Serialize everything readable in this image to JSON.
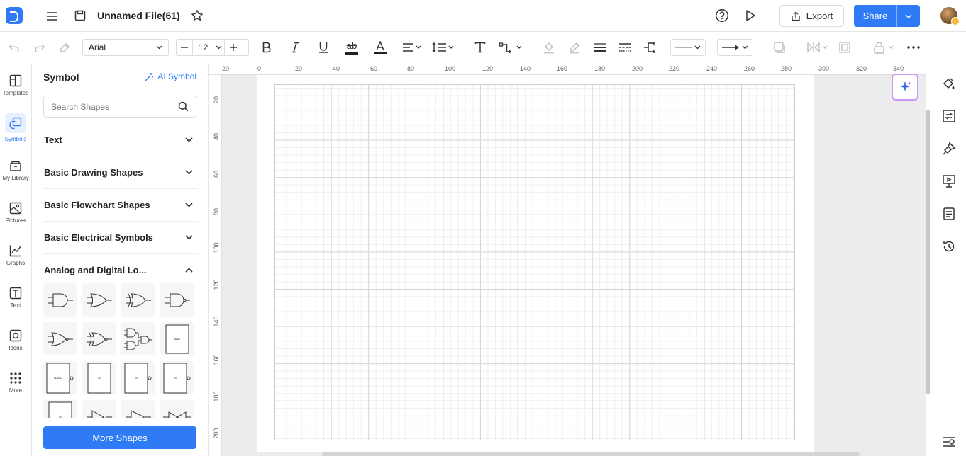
{
  "header": {
    "file_title": "Unnamed File(61)",
    "export_label": "Export",
    "share_label": "Share"
  },
  "toolbar": {
    "font_family": "Arial",
    "font_size": "12",
    "text_underline_label": "ab"
  },
  "rail": {
    "items": [
      {
        "label": "Templates",
        "icon": "templates-icon"
      },
      {
        "label": "Symbols",
        "icon": "symbols-icon"
      },
      {
        "label": "My Library",
        "icon": "library-icon"
      },
      {
        "label": "Pictures",
        "icon": "pictures-icon"
      },
      {
        "label": "Graphs",
        "icon": "graphs-icon"
      },
      {
        "label": "Text",
        "icon": "text-icon"
      },
      {
        "label": "Icons",
        "icon": "icons-icon"
      },
      {
        "label": "More",
        "icon": "more-icon"
      }
    ],
    "active": "Symbols"
  },
  "panel": {
    "title": "Symbol",
    "ai_symbol_label": "AI Symbol",
    "search_placeholder": "Search Shapes",
    "categories": [
      {
        "label": "Text",
        "expanded": false
      },
      {
        "label": "Basic Drawing Shapes",
        "expanded": false
      },
      {
        "label": "Basic Flowchart Shapes",
        "expanded": false
      },
      {
        "label": "Basic Electrical Symbols",
        "expanded": false
      },
      {
        "label": "Analog and Digital Lo...",
        "expanded": true
      }
    ],
    "shape_labels": [
      "AND",
      "NAND"
    ],
    "more_shapes_label": "More Shapes"
  },
  "ruler": {
    "horizontal": [
      "20",
      "0",
      "20",
      "40",
      "60",
      "80",
      "100",
      "120",
      "140",
      "160",
      "180",
      "200",
      "220",
      "240",
      "260",
      "280",
      "300",
      "320",
      "340"
    ],
    "vertical": [
      "20",
      "40",
      "60",
      "80",
      "100",
      "120",
      "140",
      "160",
      "180",
      "200"
    ]
  },
  "colors": {
    "accent": "#2f7bf5",
    "ai_border": "#c89af5"
  }
}
